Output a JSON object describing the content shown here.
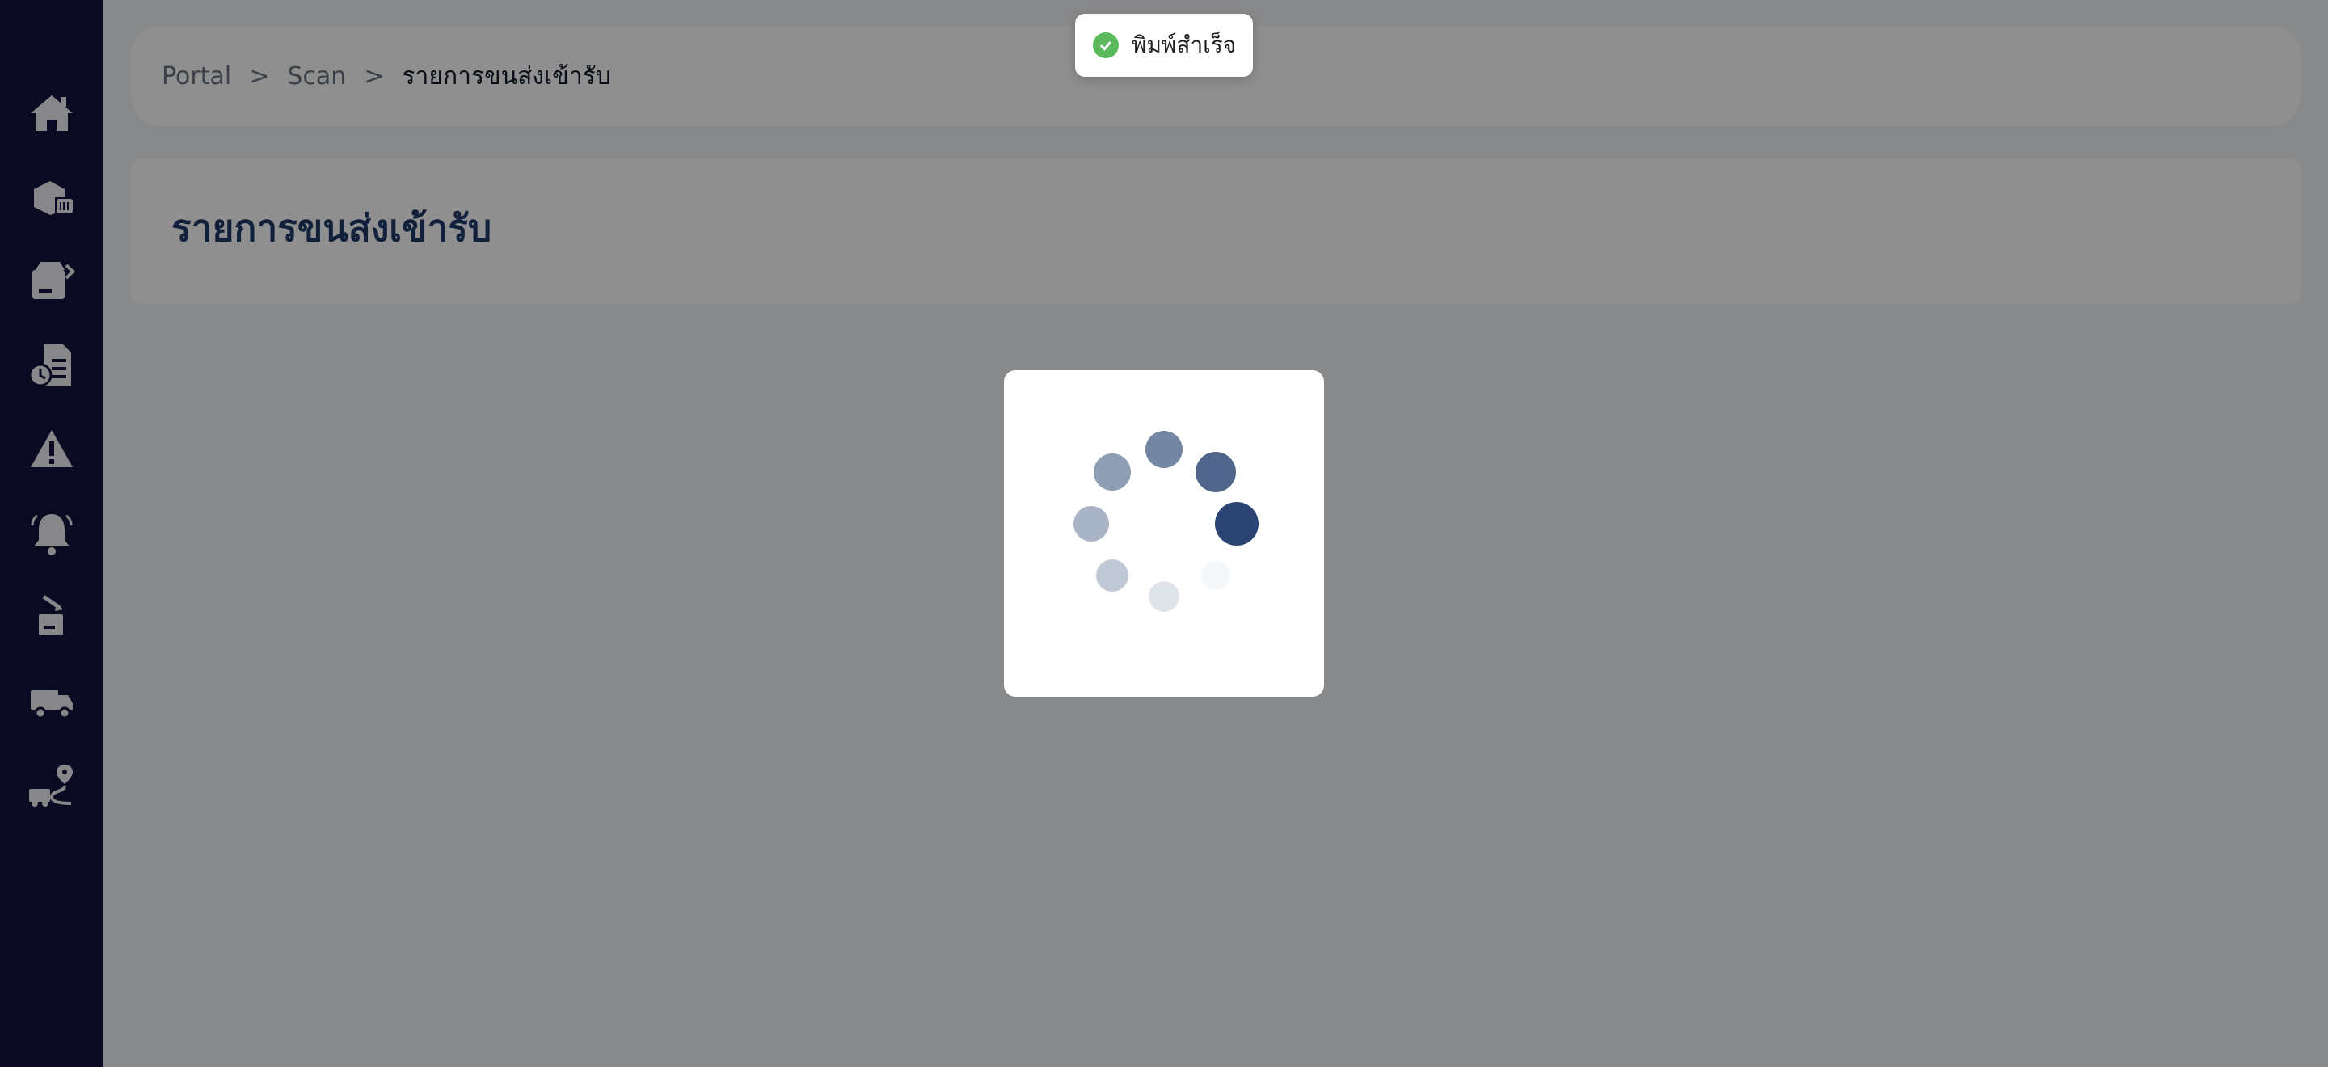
{
  "breadcrumb": {
    "items": [
      "Portal",
      "Scan",
      "รายการขนส่งเข้ารับ"
    ],
    "separator": ">"
  },
  "page": {
    "title": "รายการขนส่งเข้ารับ"
  },
  "sidebar": {
    "items": [
      {
        "icon": "home-icon"
      },
      {
        "icon": "package-scan-icon"
      },
      {
        "icon": "parcel-receive-icon"
      },
      {
        "icon": "report-clock-icon"
      },
      {
        "icon": "warning-icon"
      },
      {
        "icon": "bell-icon"
      },
      {
        "icon": "box-drop-icon"
      },
      {
        "icon": "truck-icon"
      },
      {
        "icon": "route-truck-icon"
      }
    ]
  },
  "toast": {
    "message": "พิมพ์สำเร็จ",
    "status": "success",
    "color": "#5cb85c"
  },
  "loading": {
    "visible": true,
    "color": "#1f3b6b"
  },
  "colors": {
    "sidebar_bg": "#13143d",
    "title": "#1f3b6b"
  }
}
